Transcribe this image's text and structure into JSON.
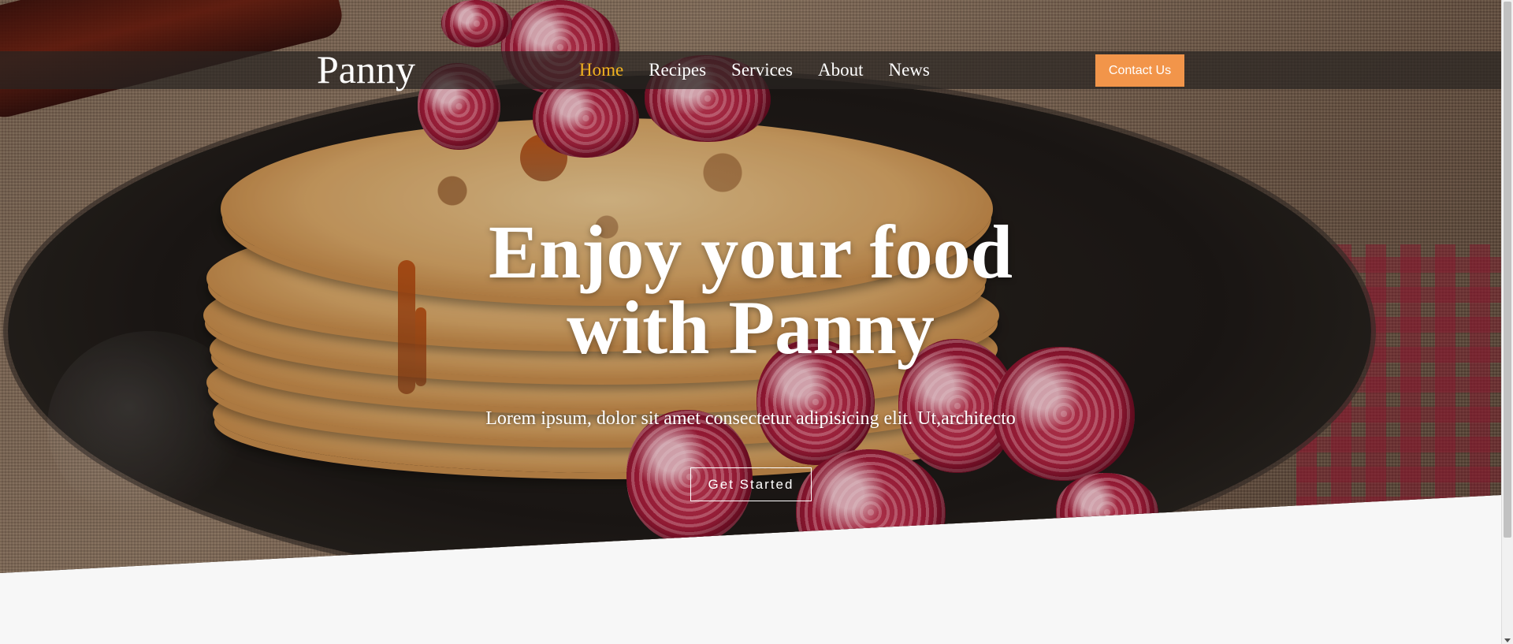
{
  "brand": "Panny",
  "nav": {
    "items": [
      {
        "label": "Home",
        "active": true
      },
      {
        "label": "Recipes",
        "active": false
      },
      {
        "label": "Services",
        "active": false
      },
      {
        "label": "About",
        "active": false
      },
      {
        "label": "News",
        "active": false
      }
    ],
    "contact_label": "Contact Us"
  },
  "hero": {
    "title_line1": "Enjoy your food",
    "title_line2": "with Panny",
    "subtitle": "Lorem ipsum, dolor sit amet consectetur adipisicing elit. Ut,architecto",
    "cta_label": "Get Started"
  },
  "colors": {
    "accent": "#f2954a",
    "active_nav": "#f2b21f",
    "page_background": "#f7f7f7"
  },
  "icons": {
    "scroll_down": "chevron-down-icon"
  }
}
